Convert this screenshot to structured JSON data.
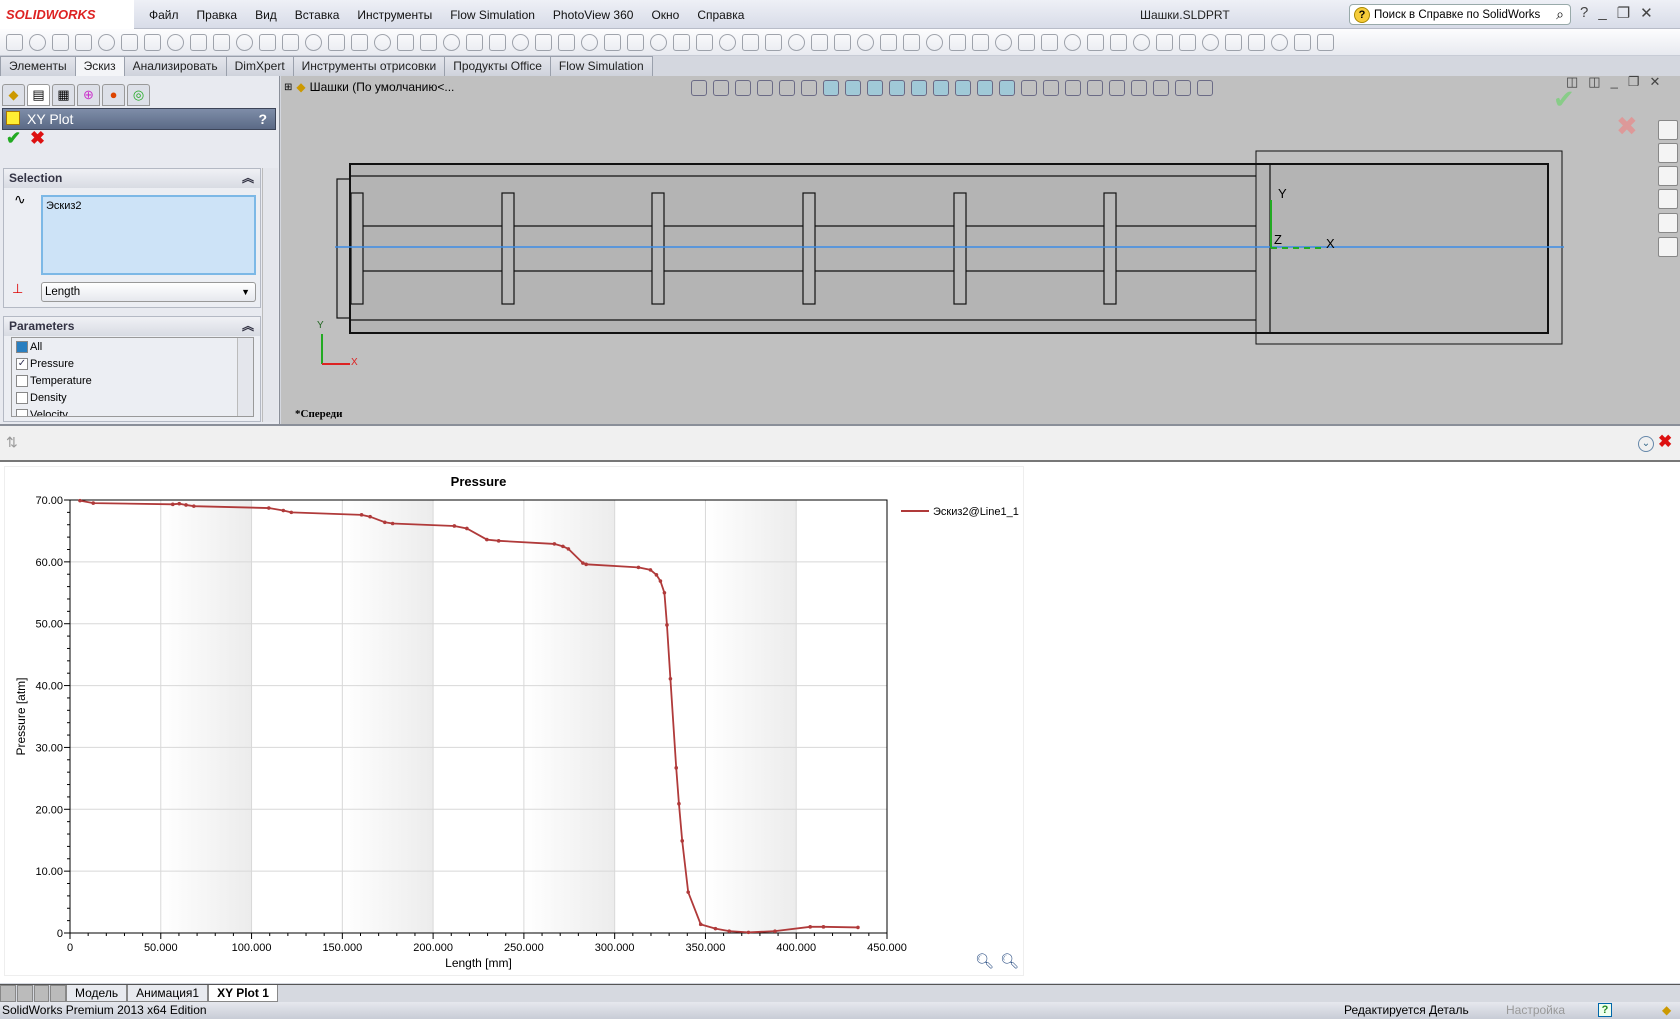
{
  "app": {
    "logo": "SOLIDWORKS",
    "document_title": "Шашки.SLDPRT",
    "help_search_placeholder": "Поиск в Справке по SolidWorks",
    "edition": "SolidWorks Premium 2013 x64 Edition"
  },
  "menu": [
    "Файл",
    "Правка",
    "Вид",
    "Вставка",
    "Инструменты",
    "Flow Simulation",
    "PhotoView 360",
    "Окно",
    "Справка"
  ],
  "command_tabs": [
    {
      "label": "Элементы"
    },
    {
      "label": "Эскиз",
      "active": true
    },
    {
      "label": "Анализировать"
    },
    {
      "label": "DimXpert"
    },
    {
      "label": "Инструменты отрисовки"
    },
    {
      "label": "Продукты Office"
    },
    {
      "label": "Flow Simulation"
    }
  ],
  "feature_tree": {
    "root": "Шашки  (По умолчанию<..."
  },
  "property_manager": {
    "title": "XY Plot",
    "help": "?",
    "selection": {
      "header": "Selection",
      "items": [
        "Эскиз2"
      ],
      "x_axis": "Length"
    },
    "parameters": {
      "header": "Parameters",
      "items": [
        {
          "label": "All",
          "checked": false,
          "partial": true
        },
        {
          "label": "Pressure",
          "checked": true
        },
        {
          "label": "Temperature",
          "checked": false
        },
        {
          "label": "Density",
          "checked": false
        },
        {
          "label": "Velocity",
          "checked": false
        }
      ]
    }
  },
  "viewport": {
    "view_name": "*Спереди",
    "triad": {
      "x": "X",
      "y": "Y",
      "z": "Z"
    },
    "accent": "#3c8ce6"
  },
  "chart_data": {
    "type": "line",
    "title": "Pressure",
    "xlabel": "Length [mm]",
    "ylabel": "Pressure [atm]",
    "xlim": [
      0,
      450
    ],
    "ylim": [
      0,
      70
    ],
    "xticks": [
      "0",
      "50.000",
      "100.000",
      "150.000",
      "200.000",
      "250.000",
      "300.000",
      "350.000",
      "400.000",
      "450.000"
    ],
    "yticks": [
      "0",
      "10.00",
      "20.00",
      "30.00",
      "40.00",
      "50.00",
      "60.00",
      "70.00"
    ],
    "grid": true,
    "legend_placement": "right",
    "series": [
      {
        "name": "Эскиз2@Line1_1",
        "color": "#b03a3a",
        "x": [
          5.5,
          12.8,
          56.6,
          60.2,
          63.9,
          68.2,
          109.5,
          117.5,
          121.9,
          160.6,
          165.3,
          173.4,
          177.7,
          211.7,
          218.6,
          229.6,
          236.1,
          266.8,
          271.5,
          274.5,
          282.5,
          284.3,
          313.1,
          319.7,
          323.0,
          325.2,
          327.4,
          328.8,
          330.7,
          333.9,
          335.4,
          337.2,
          340.5,
          347.4,
          355.5,
          363.1,
          373.7,
          388.3,
          407.7,
          415.0,
          434.0
        ],
        "y": [
          69.9,
          69.5,
          69.3,
          69.4,
          69.2,
          69.0,
          68.7,
          68.3,
          68.0,
          67.6,
          67.3,
          66.4,
          66.2,
          65.8,
          65.4,
          63.6,
          63.4,
          62.9,
          62.5,
          62.1,
          59.8,
          59.6,
          59.1,
          58.7,
          57.9,
          56.9,
          55.0,
          49.8,
          41.1,
          26.7,
          20.9,
          14.9,
          6.6,
          1.4,
          0.7,
          0.3,
          0.1,
          0.3,
          1.0,
          1.0,
          0.9
        ]
      }
    ]
  },
  "bottom_tabs": [
    {
      "label": "Модель"
    },
    {
      "label": "Анимация1"
    },
    {
      "label": "XY Plot 1",
      "active": true
    }
  ],
  "status": {
    "mode": "Редактируется Деталь",
    "customize": "Настройка"
  }
}
